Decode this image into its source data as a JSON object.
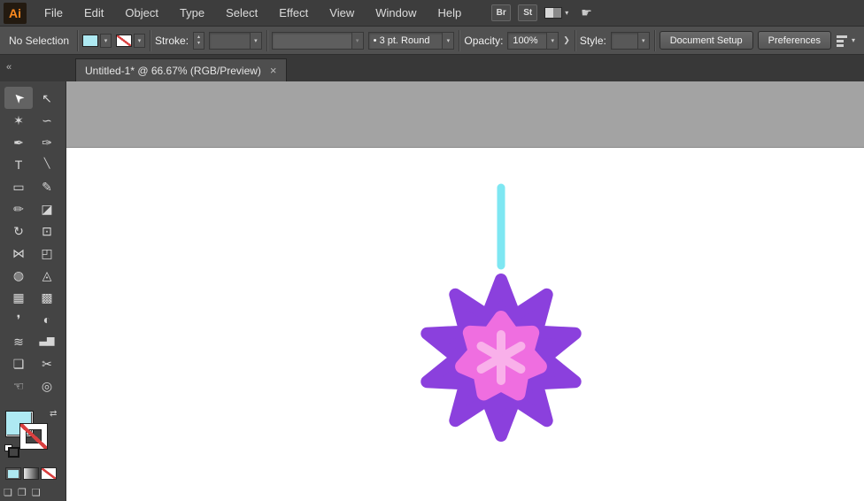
{
  "app": {
    "logo_text": "Ai"
  },
  "icons": {
    "caret": "▾",
    "caret_up": "▴",
    "close": "×",
    "collapse": "«",
    "swap": "⇄",
    "panel_arrow": "❯",
    "bullet": "•",
    "touch_hand": "☛",
    "draw_normal": "❏",
    "draw_behind": "❐",
    "draw_inside": "❑"
  },
  "menubar": {
    "items": [
      {
        "name": "menu-file",
        "label": "File"
      },
      {
        "name": "menu-edit",
        "label": "Edit"
      },
      {
        "name": "menu-object",
        "label": "Object"
      },
      {
        "name": "menu-type",
        "label": "Type"
      },
      {
        "name": "menu-select",
        "label": "Select"
      },
      {
        "name": "menu-effect",
        "label": "Effect"
      },
      {
        "name": "menu-view",
        "label": "View"
      },
      {
        "name": "menu-window",
        "label": "Window"
      },
      {
        "name": "menu-help",
        "label": "Help"
      }
    ],
    "bridge_label": "Br",
    "stock_label": "St"
  },
  "control_bar": {
    "selection_status": "No Selection",
    "stroke_label": "Stroke:",
    "stroke_weight_value": "",
    "brush_value": "3 pt. Round",
    "opacity_label": "Opacity:",
    "opacity_value": "100%",
    "style_label": "Style:",
    "style_value": "",
    "document_setup_label": "Document Setup",
    "preferences_label": "Preferences"
  },
  "document_tab": {
    "title": "Untitled-1* @ 66.67% (RGB/Preview)"
  },
  "tool_panel": {
    "tools": [
      {
        "name": "selection-tool",
        "glyph": "➤",
        "selected": true
      },
      {
        "name": "direct-selection-tool",
        "glyph": "↖"
      },
      {
        "name": "magic-wand-tool",
        "glyph": "✶"
      },
      {
        "name": "lasso-tool",
        "glyph": "∽"
      },
      {
        "name": "pen-tool",
        "glyph": "✒"
      },
      {
        "name": "curvature-tool",
        "glyph": "✑"
      },
      {
        "name": "type-tool",
        "glyph": "T"
      },
      {
        "name": "line-segment-tool",
        "glyph": "╲"
      },
      {
        "name": "rectangle-tool",
        "glyph": "▭"
      },
      {
        "name": "paintbrush-tool",
        "glyph": "✎"
      },
      {
        "name": "pencil-tool",
        "glyph": "✏"
      },
      {
        "name": "eraser-tool",
        "glyph": "◪"
      },
      {
        "name": "rotate-tool",
        "glyph": "↻"
      },
      {
        "name": "scale-tool",
        "glyph": "⊡"
      },
      {
        "name": "width-tool",
        "glyph": "⋈"
      },
      {
        "name": "free-transform-tool",
        "glyph": "◰"
      },
      {
        "name": "shape-builder-tool",
        "glyph": "◍"
      },
      {
        "name": "perspective-grid-tool",
        "glyph": "◬"
      },
      {
        "name": "mesh-tool",
        "glyph": "▦"
      },
      {
        "name": "gradient-tool",
        "glyph": "▩"
      },
      {
        "name": "eyedropper-tool",
        "glyph": "❜"
      },
      {
        "name": "blend-tool",
        "glyph": "◐"
      },
      {
        "name": "symbol-sprayer-tool",
        "glyph": "≋"
      },
      {
        "name": "column-graph-tool",
        "glyph": "▃▆"
      },
      {
        "name": "artboard-tool",
        "glyph": "❏"
      },
      {
        "name": "slice-tool",
        "glyph": "✂"
      },
      {
        "name": "hand-tool",
        "glyph": "☜"
      },
      {
        "name": "zoom-tool",
        "glyph": "◎"
      }
    ]
  },
  "artwork": {
    "colors": {
      "stick": "#7ee7f2",
      "burst": "#8b40dd",
      "inner_star": "#ef6ee0",
      "asterisk": "#f9b0ea",
      "fill_swatch": "#aee9f2",
      "none_red": "#d94040"
    }
  }
}
